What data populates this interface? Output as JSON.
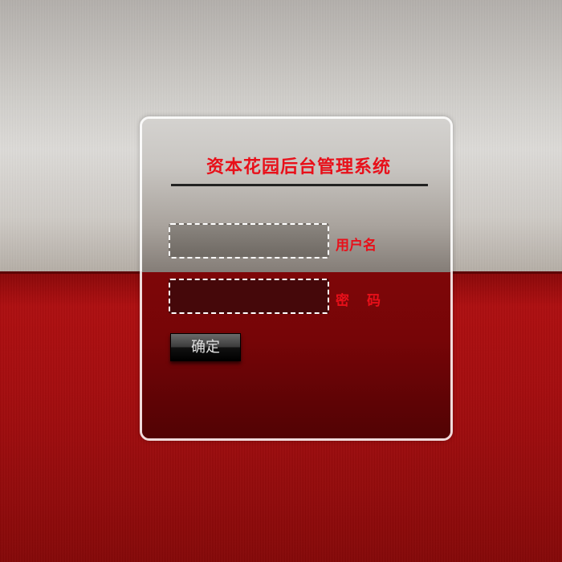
{
  "app": {
    "title": "资本花园后台管理系统"
  },
  "login": {
    "username": {
      "label": "用户名",
      "value": "",
      "placeholder": ""
    },
    "password": {
      "label": "密码",
      "value": "",
      "placeholder": ""
    },
    "submit_label": "确定"
  },
  "colors": {
    "accent": "#e8101a",
    "background_top": "#d3d1cd",
    "background_bottom": "#a80c0e",
    "button": "#1a1a1a"
  }
}
